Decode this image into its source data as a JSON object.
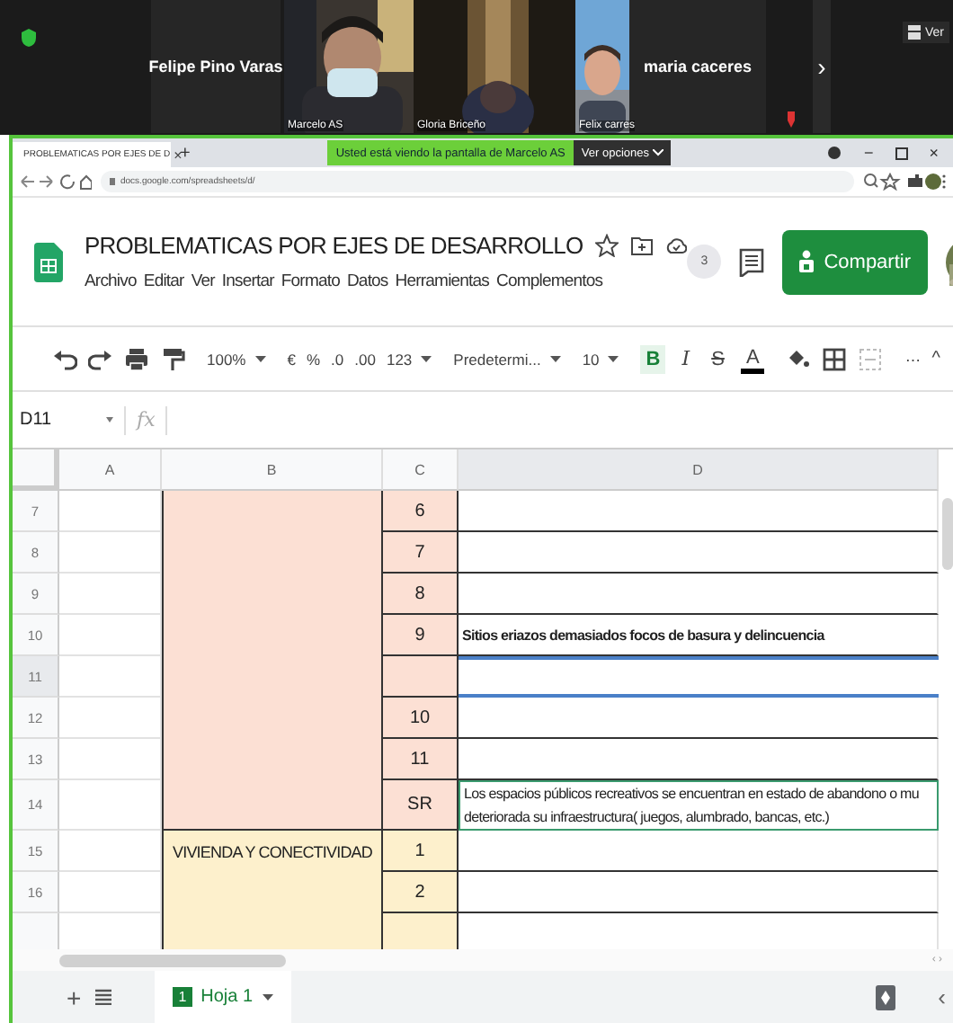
{
  "meeting": {
    "participants": [
      {
        "name": "Felipe Pino Varas",
        "kind": "tile"
      },
      {
        "name": "Marcelo AS",
        "kind": "video"
      },
      {
        "name": "Gloria Briceño",
        "kind": "video"
      },
      {
        "name": "Felix carres",
        "kind": "video"
      },
      {
        "name": "maria caceres",
        "kind": "tile"
      }
    ],
    "next": "›",
    "view_button": "Ver",
    "banner": {
      "message": "Usted está viendo la pantalla de Marcelo AS",
      "options": "Ver opciones"
    }
  },
  "browser": {
    "tab": {
      "title": "PROBLEMATICAS POR EJES DE D",
      "close": "×"
    },
    "new_tab": "+",
    "url": "docs.google.com/spreadsheets/d/",
    "minimize": "−",
    "close": "×"
  },
  "sheet": {
    "title": "PROBLEMATICAS POR EJES DE DESARROLLO",
    "menu": [
      "Archivo",
      "Editar",
      "Ver",
      "Insertar",
      "Formato",
      "Datos",
      "Herramientas",
      "Complementos"
    ],
    "viewers": "3",
    "share": "Compartir",
    "toolbar": [
      {
        "kind": "icon"
      },
      {
        "kind": "icon"
      },
      {
        "kind": "icon"
      },
      {
        "kind": "icon"
      },
      {
        "kind": "sep"
      },
      {
        "kind": "dropdown",
        "label": "100%"
      },
      {
        "kind": "sep"
      },
      {
        "kind": "text",
        "label": "€"
      },
      {
        "kind": "text",
        "label": "%"
      },
      {
        "kind": "text",
        "label": ".0"
      },
      {
        "kind": "text",
        "label": ".00"
      },
      {
        "kind": "dropdown",
        "label": "123"
      },
      {
        "kind": "sep"
      },
      {
        "kind": "dropdown",
        "label": "Predetermi..."
      },
      {
        "kind": "sep"
      },
      {
        "kind": "dropdown",
        "label": "10"
      },
      {
        "kind": "sep"
      },
      {
        "kind": "format",
        "label": "B",
        "selected": true
      },
      {
        "kind": "format",
        "label": "I",
        "selected": false
      },
      {
        "kind": "format",
        "label": "S",
        "selected": false
      },
      {
        "kind": "format",
        "label": "A",
        "selected": false
      },
      {
        "kind": "sep"
      },
      {
        "kind": "icon"
      },
      {
        "kind": "icon"
      },
      {
        "kind": "icon"
      },
      {
        "kind": "sep"
      },
      {
        "kind": "text",
        "label": "⋯"
      }
    ],
    "collapse": "^",
    "cell_ref": "D11",
    "fx": "fx",
    "columns": [
      "A",
      "B",
      "C",
      "D"
    ],
    "groups": [
      {
        "color": "#fce0d4",
        "rows": [
          {
            "number": "7",
            "c": "6",
            "selected": false
          },
          {
            "number": "8",
            "c": "7",
            "selected": false
          },
          {
            "number": "9",
            "c": "8",
            "selected": false
          },
          {
            "number": "10",
            "c": "9",
            "d": [
              "Sitios eriazos demasiados focos de basura y delincuencia"
            ],
            "d_bold": true,
            "selected": false
          },
          {
            "number": "11",
            "selected": true
          },
          {
            "number": "12",
            "c": "10",
            "selected": false
          },
          {
            "number": "13",
            "c": "11",
            "selected": false
          },
          {
            "number": "14",
            "c": "SR",
            "d": [
              "Los espacios públicos recreativos se encuentran en estado de abandono o mu",
              "deteriorada su infraestructura( juegos,  alumbrado, bancas, etc.)"
            ],
            "d_bold": false,
            "selected": false
          }
        ]
      },
      {
        "label": "VIVIENDA Y CONECTIVIDAD",
        "color": "#fdf0cc",
        "rows": [
          {
            "number": "15",
            "c": "1",
            "selected": false
          },
          {
            "number": "16",
            "c": "2",
            "selected": false
          }
        ]
      }
    ],
    "scroll_arrows": "‹ ›",
    "sheet_tabs": [
      {
        "number": "1",
        "label": "Hoja 1",
        "selected": true
      }
    ],
    "add_sheet": "+",
    "prev": "‹"
  }
}
